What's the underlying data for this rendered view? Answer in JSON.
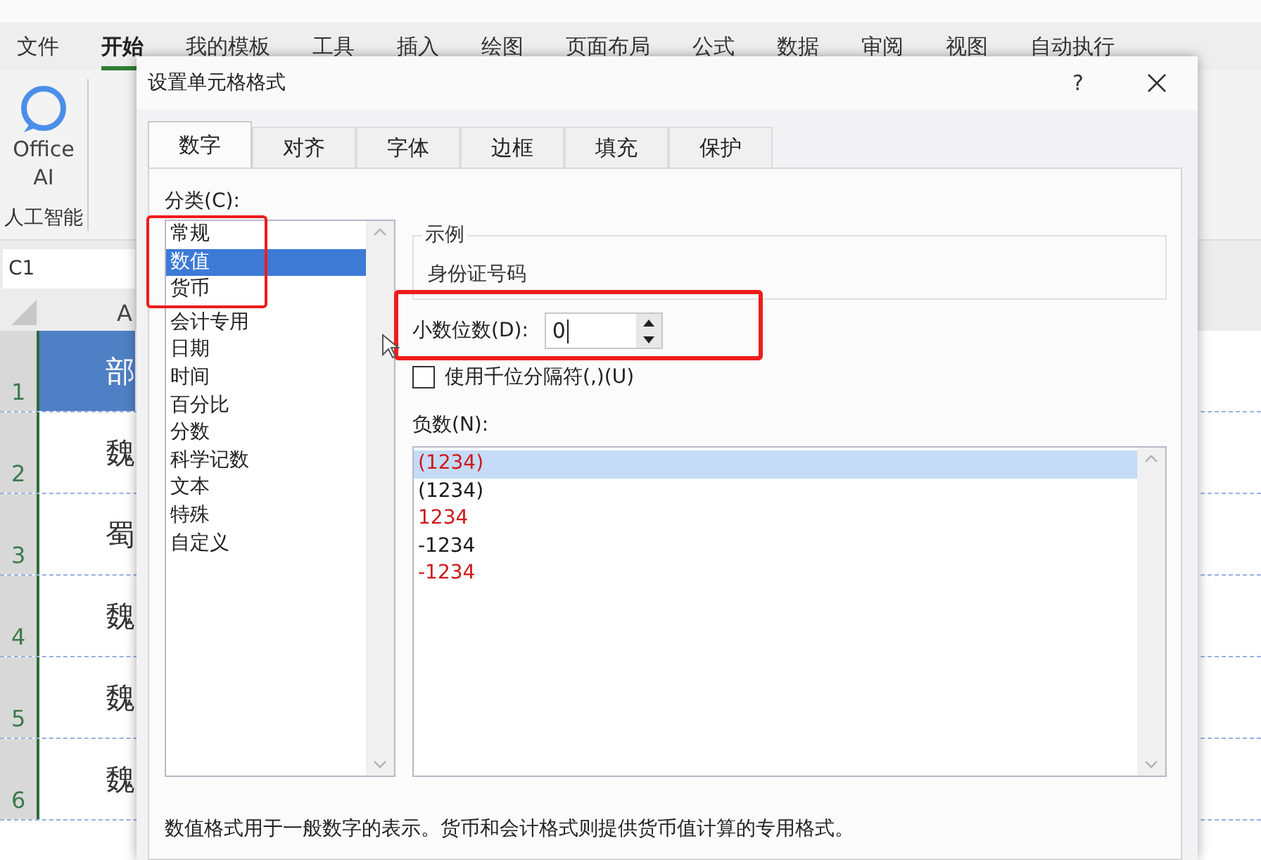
{
  "app_tabs": [
    {
      "label": "文件",
      "selected": false
    },
    {
      "label": "开始",
      "selected": true
    },
    {
      "label": "我的模板",
      "selected": false
    },
    {
      "label": "工具",
      "selected": false
    },
    {
      "label": "插入",
      "selected": false
    },
    {
      "label": "绘图",
      "selected": false
    },
    {
      "label": "页面布局",
      "selected": false
    },
    {
      "label": "公式",
      "selected": false
    },
    {
      "label": "数据",
      "selected": false
    },
    {
      "label": "审阅",
      "selected": false
    },
    {
      "label": "视图",
      "selected": false
    },
    {
      "label": "自动执行",
      "selected": false
    }
  ],
  "ribbon": {
    "ai_button": "Office AI",
    "group_label": "人工智能"
  },
  "name_box": "C1",
  "column_header": "A",
  "rows": [
    {
      "number": "1",
      "cell": "部",
      "kind": "header"
    },
    {
      "number": "2",
      "cell": "魏",
      "kind": "data"
    },
    {
      "number": "3",
      "cell": "蜀",
      "kind": "data"
    },
    {
      "number": "4",
      "cell": "魏",
      "kind": "data"
    },
    {
      "number": "5",
      "cell": "魏",
      "kind": "data"
    },
    {
      "number": "6",
      "cell": "魏",
      "kind": "data"
    }
  ],
  "dialog": {
    "title": "设置单元格格式",
    "help": "?",
    "tabs": [
      {
        "label": "数字",
        "selected": true
      },
      {
        "label": "对齐",
        "selected": false
      },
      {
        "label": "字体",
        "selected": false
      },
      {
        "label": "边框",
        "selected": false
      },
      {
        "label": "填充",
        "selected": false
      },
      {
        "label": "保护",
        "selected": false
      }
    ],
    "category_label": "分类(C):",
    "categories": [
      {
        "label": "常规",
        "selected": false
      },
      {
        "label": "数值",
        "selected": true
      },
      {
        "label": "货币",
        "selected": false
      },
      {
        "label": "会计专用",
        "selected": false
      },
      {
        "label": "日期",
        "selected": false
      },
      {
        "label": "时间",
        "selected": false
      },
      {
        "label": "百分比",
        "selected": false
      },
      {
        "label": "分数",
        "selected": false
      },
      {
        "label": "科学记数",
        "selected": false
      },
      {
        "label": "文本",
        "selected": false
      },
      {
        "label": "特殊",
        "selected": false
      },
      {
        "label": "自定义",
        "selected": false
      }
    ],
    "sample_label": "示例",
    "sample_value": "身份证号码",
    "decimal_label": "小数位数(D):",
    "decimal_value": "0",
    "thousands": {
      "label": "使用千位分隔符(,)(U)",
      "checked": false
    },
    "negative_label": "负数(N):",
    "negatives": [
      {
        "label": "(1234)",
        "color": "#d01818",
        "selected": true
      },
      {
        "label": "(1234)",
        "color": "#1a1a1a",
        "selected": false
      },
      {
        "label": "1234",
        "color": "#d01818",
        "selected": false
      },
      {
        "label": "-1234",
        "color": "#1a1a1a",
        "selected": false
      },
      {
        "label": "-1234",
        "color": "#d01818",
        "selected": false
      }
    ],
    "description": "数值格式用于一般数字的表示。货币和会计格式则提供货币值计算的专用格式。",
    "category_highlighted": true,
    "decimal_highlighted": true
  }
}
